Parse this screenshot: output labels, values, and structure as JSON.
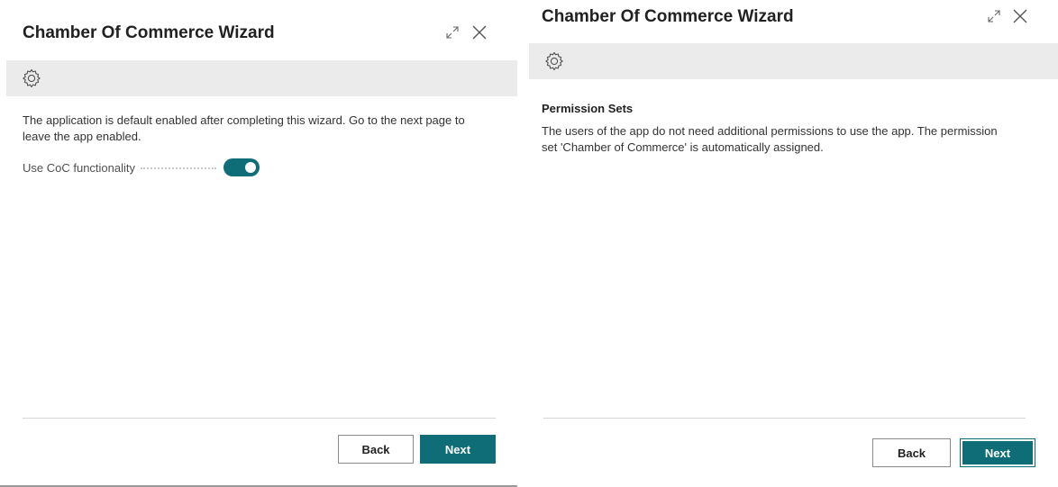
{
  "left_panel": {
    "title": "Chamber Of Commerce Wizard",
    "icons": {
      "expand": "expand-icon",
      "close": "close-icon",
      "banner": "gear-icon"
    },
    "intro_text": "The application is default enabled after completing this wizard. Go to the next page to leave the app enabled.",
    "field": {
      "label": "Use CoC functionality",
      "toggle_on": true
    },
    "buttons": {
      "back": "Back",
      "next": "Next"
    }
  },
  "right_panel": {
    "title": "Chamber Of Commerce Wizard",
    "icons": {
      "expand": "expand-icon",
      "close": "close-icon",
      "banner": "gear-icon"
    },
    "section_title": "Permission Sets",
    "permission_text": "The users of the app do not need additional permissions to use the app. The permission set 'Chamber of Commerce' is automatically assigned.",
    "buttons": {
      "back": "Back",
      "next": "Next"
    }
  },
  "colors": {
    "accent": "#0f6d77",
    "banner_bg": "#ebebeb",
    "text": "#212121"
  }
}
